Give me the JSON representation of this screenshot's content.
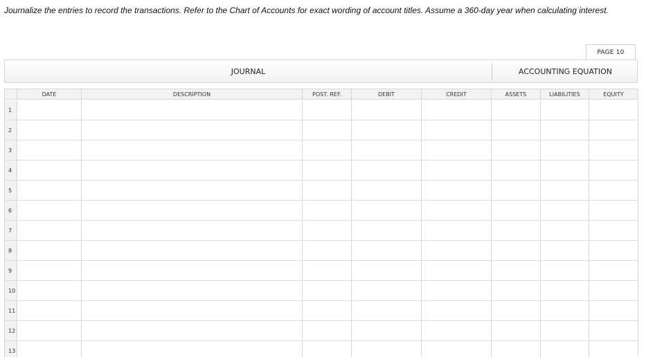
{
  "instructions": "Journalize the entries to record the transactions. Refer to the Chart of Accounts for exact wording of account titles. Assume a 360-day year when calculating interest.",
  "page_tab": "PAGE 10",
  "journal_title": "JOURNAL",
  "equation_title": "ACCOUNTING EQUATION",
  "columns": {
    "date": "DATE",
    "description": "DESCRIPTION",
    "post_ref": "POST. REF.",
    "debit": "DEBIT",
    "credit": "CREDIT",
    "assets": "ASSETS",
    "liabilities": "LIABILITIES",
    "equity": "EQUITY"
  },
  "rows": [
    "1",
    "2",
    "3",
    "4",
    "5",
    "6",
    "7",
    "8",
    "9",
    "10",
    "11",
    "12",
    "13"
  ]
}
